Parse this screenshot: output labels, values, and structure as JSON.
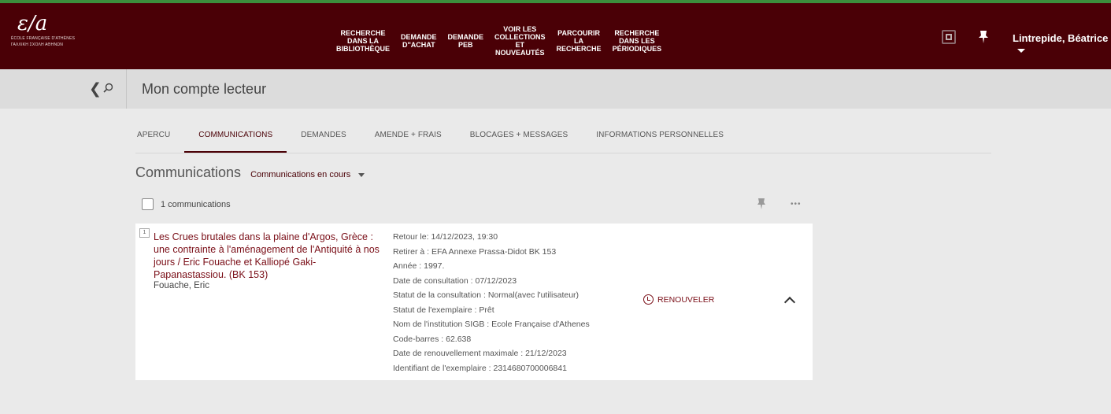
{
  "header": {
    "logo": {
      "mark": "ε/a",
      "line1": "ÉCOLE FRANÇAISE D'ATHÈNES",
      "line2": "ΓΑΛΛΙΚΗ ΣΧΟΛΗ ΑΘΗΝΩΝ"
    },
    "nav": [
      {
        "label": "RECHERCHE\nDANS LA\nBIBLIOTHÈQUE"
      },
      {
        "label": "DEMANDE\nD''ACHAT"
      },
      {
        "label": "DEMANDE\nPEB"
      },
      {
        "label": "VOIR LES\nCOLLECTIONS\nET\nNOUVEAUTÉS"
      },
      {
        "label": "PARCOURIR\nLA\nRECHERCHE"
      },
      {
        "label": "RECHERCHE\nDANS LES\nPÉRIODIQUES"
      }
    ],
    "icons": {
      "qr": "qr-code-icon",
      "pin": "pin-icon"
    },
    "user": "Lintrepide, Béatrice"
  },
  "subheader": {
    "title": "Mon compte lecteur"
  },
  "tabs": [
    {
      "label": "APERCU"
    },
    {
      "label": "COMMUNICATIONS",
      "active": true
    },
    {
      "label": "DEMANDES"
    },
    {
      "label": "AMENDE + FRAIS"
    },
    {
      "label": "BLOCAGES + MESSAGES"
    },
    {
      "label": "INFORMATIONS PERSONNELLES"
    }
  ],
  "communications": {
    "title": "Communications",
    "filter": "Communications en cours",
    "count_label": "1 communications",
    "items": [
      {
        "number": "1",
        "title": "Les Crues brutales dans la plaine d'Argos, Grèce : une contrainte à l'aménagement de l'Antiquité à nos jours / Eric Fouache et Kalliopé Gaki-Papanastassiou. (BK 153)",
        "author": "Fouache, Eric",
        "details": [
          "Retour le: 14/12/2023, 19:30",
          "Retirer à : EFA Annexe Prassa-Didot BK 153",
          "Année : 1997.",
          "Date de consultation : 07/12/2023",
          "Statut de la consultation : Normal(avec l'utilisateur)",
          "Statut de l'exemplaire : Prêt",
          "Nom de l'institution SIGB : Ecole Française d'Athenes",
          "Code-barres : 62.638",
          "Date de renouvellement maximale : 21/12/2023",
          "Identifiant de l'exemplaire : 2314680700006841"
        ],
        "renew_label": "RENOUVELER"
      }
    ]
  },
  "colors": {
    "header_bg": "#4a0006",
    "accent": "#7a0e17",
    "top_line": "#3b8f3c"
  }
}
